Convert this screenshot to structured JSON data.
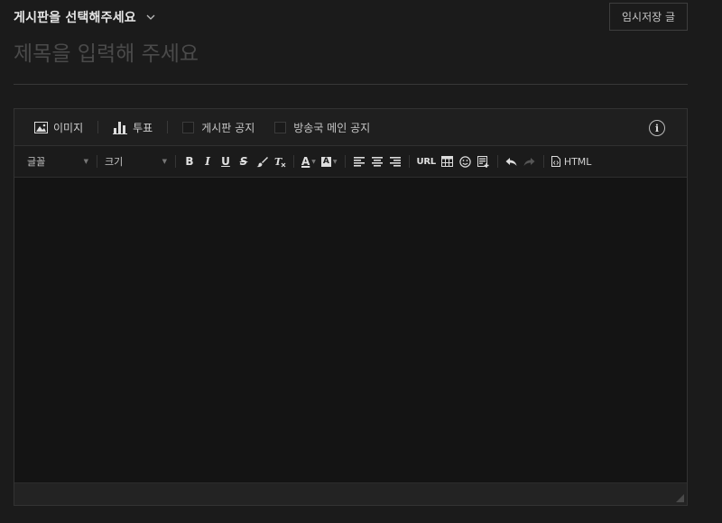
{
  "header": {
    "board_select_label": "게시판을 선택해주세요",
    "draft_button_label": "임시저장 글"
  },
  "title": {
    "placeholder": "제목을 입력해 주세요"
  },
  "editor": {
    "topbar": {
      "image_label": "이미지",
      "poll_label": "투표",
      "board_notice_label": "게시판 공지",
      "station_notice_label": "방송국 메인 공지",
      "info_glyph": "i"
    },
    "format": {
      "font_label": "글꼴",
      "size_label": "크기",
      "bold": "B",
      "italic": "I",
      "underline": "U",
      "strike": "S",
      "font_color": "A",
      "bg_color": "A",
      "url": "URL",
      "html": "HTML"
    }
  },
  "colors": {
    "background": "#1b1b1b",
    "editor_background": "#141414",
    "border": "#333333",
    "text": "#cfcfcf"
  }
}
